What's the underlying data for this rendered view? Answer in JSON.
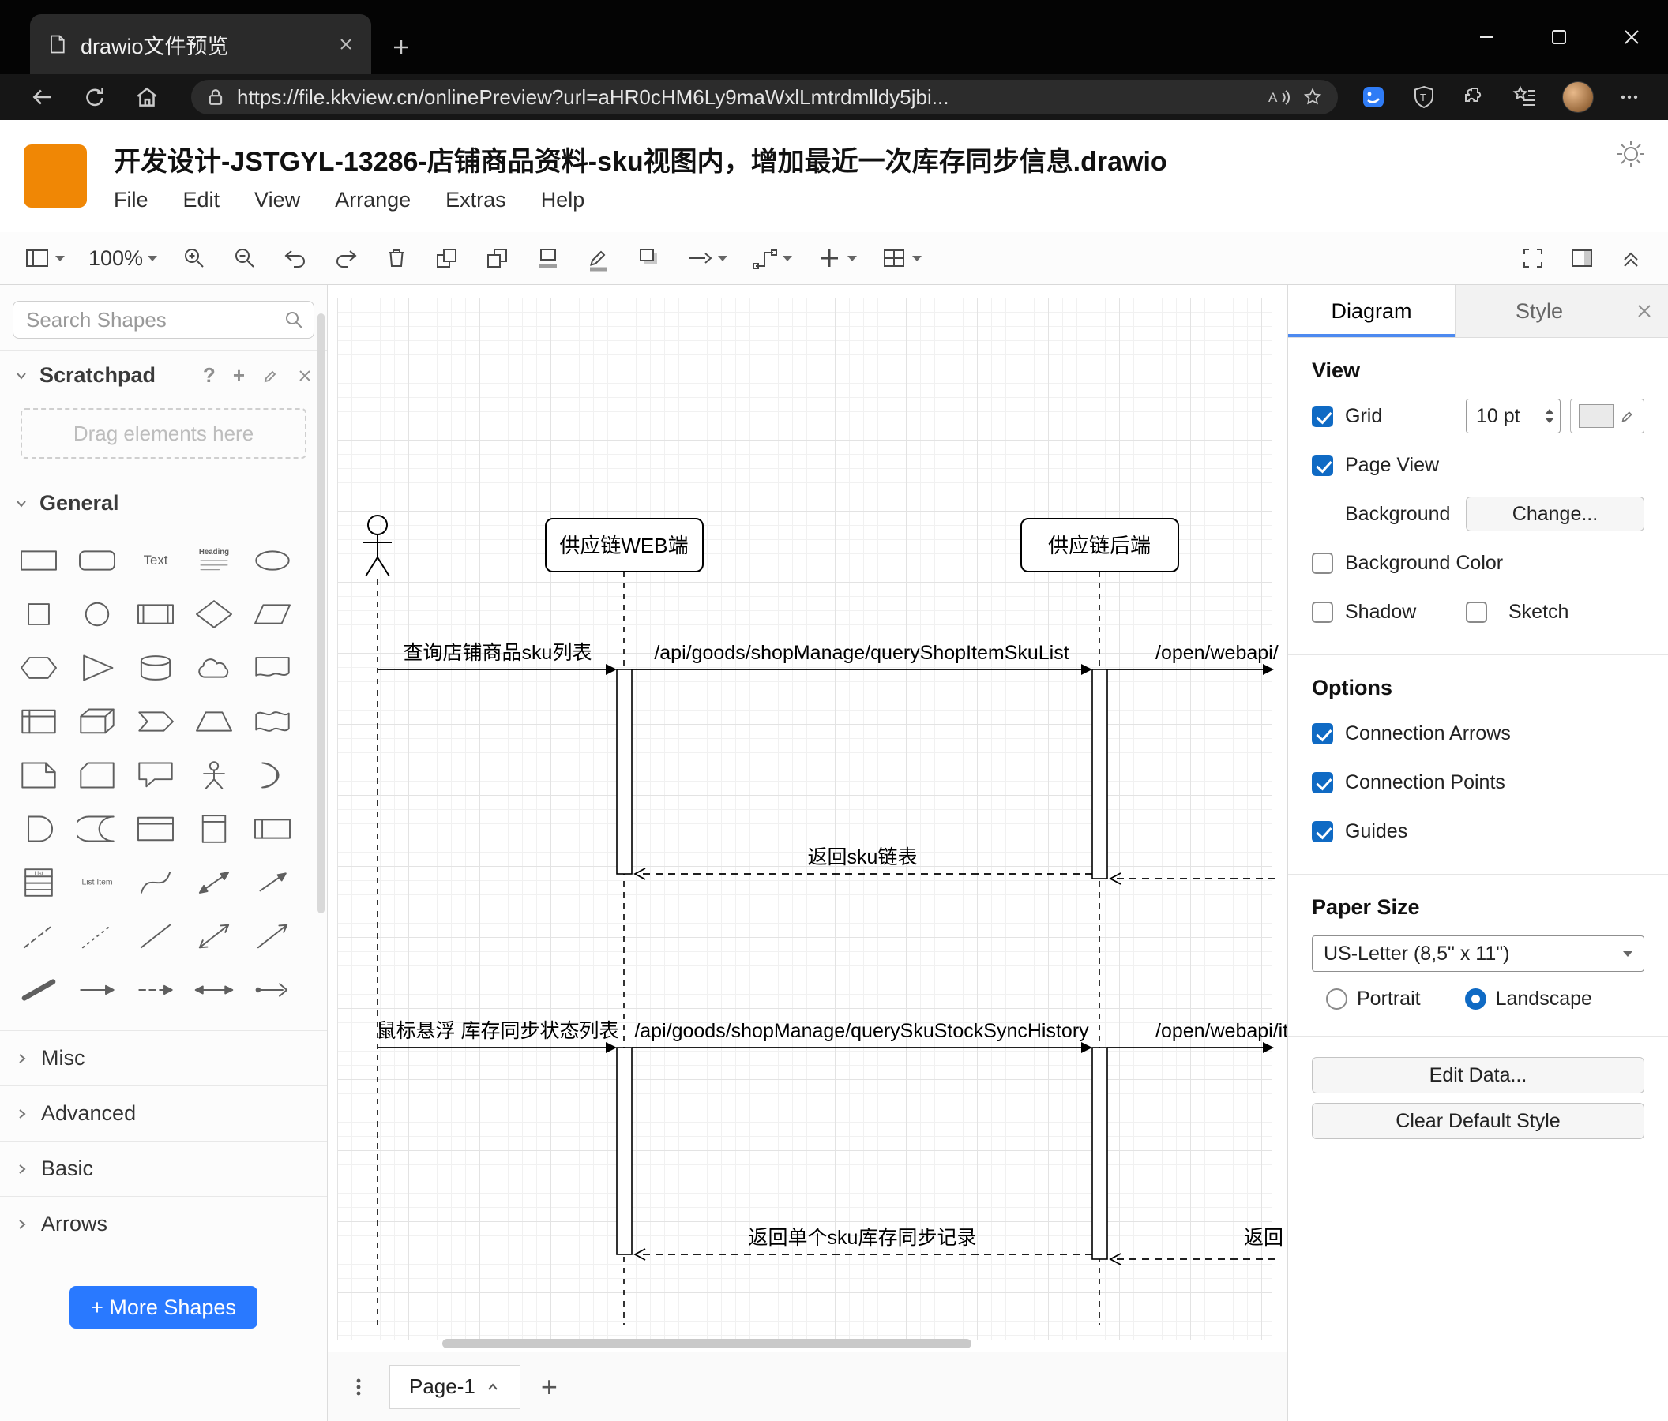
{
  "colors": {
    "accent": "#0f6ac4",
    "logo_orange": "#F08705",
    "primary_button": "#2979ff"
  },
  "icons": {
    "help": "?",
    "plus": "+"
  },
  "browser": {
    "tab_title": "drawio文件预览",
    "url": "https://file.kkview.cn/onlinePreview?url=aHR0cHM6Ly9maWxlLmtrdmlldy5jbi..."
  },
  "app": {
    "title": "开发设计-JSTGYL-13286-店铺商品资料-sku视图内，增加最近一次库存同步信息.drawio",
    "menus": [
      "File",
      "Edit",
      "View",
      "Arrange",
      "Extras",
      "Help"
    ],
    "zoom": "100%"
  },
  "sidebar": {
    "search_placeholder": "Search Shapes",
    "scratchpad_title": "Scratchpad",
    "scratchpad_hint": "Drag elements here",
    "sections": {
      "general": "General",
      "misc": "Misc",
      "advanced": "Advanced",
      "basic": "Basic",
      "arrows": "Arrows"
    },
    "more_shapes": "+ More Shapes",
    "shape_labels": {
      "text": "Text",
      "heading": "Heading",
      "list": "List",
      "list_item": "List Item"
    },
    "shapes": [
      "rectangle",
      "rounded-rectangle",
      "text",
      "textbox",
      "ellipse",
      "square",
      "circle",
      "process",
      "diamond",
      "parallelogram",
      "hexagon",
      "triangle",
      "cylinder",
      "cloud",
      "document",
      "internal-storage",
      "cube",
      "step",
      "trapezoid",
      "tape",
      "note",
      "card",
      "callout",
      "actor",
      "or",
      "and",
      "data-storage",
      "container",
      "vertical-container",
      "horizontal-container",
      "list",
      "list-item",
      "curve",
      "bidirectional-arrow",
      "arrow",
      "dashed-line",
      "dotted-line",
      "line",
      "bidirectional-connector",
      "directional-connector",
      "link",
      "arrow-right",
      "dashed-arrow",
      "double-arrow",
      "connector-arrow"
    ]
  },
  "canvas": {
    "participants": {
      "web": "供应链WEB端",
      "backend": "供应链后端"
    },
    "messages": {
      "m1": "查询店铺商品sku列表",
      "m2": "/api/goods/shopManage/queryShopItemSkuList",
      "m3": "/open/webapi/",
      "r1": "返回sku链表",
      "m4": "鼠标悬浮 库存同步状态列表",
      "m5": "/api/goods/shopManage/querySkuStockSyncHistory",
      "m6": "/open/webapi/item",
      "r2": "返回单个sku库存同步记录",
      "r3": "返回"
    },
    "page_tab": "Page-1"
  },
  "panel": {
    "tabs": [
      "Diagram",
      "Style"
    ],
    "view": {
      "title": "View",
      "grid": "Grid",
      "grid_size": "10 pt",
      "page_view": "Page View",
      "background": "Background",
      "change": "Change...",
      "background_color": "Background Color",
      "shadow": "Shadow",
      "sketch": "Sketch"
    },
    "options": {
      "title": "Options",
      "connection_arrows": "Connection Arrows",
      "connection_points": "Connection Points",
      "guides": "Guides"
    },
    "paper": {
      "title": "Paper Size",
      "size": "US-Letter (8,5\" x 11\")",
      "portrait": "Portrait",
      "landscape": "Landscape"
    },
    "buttons": {
      "edit_data": "Edit Data...",
      "clear_style": "Clear Default Style"
    }
  }
}
